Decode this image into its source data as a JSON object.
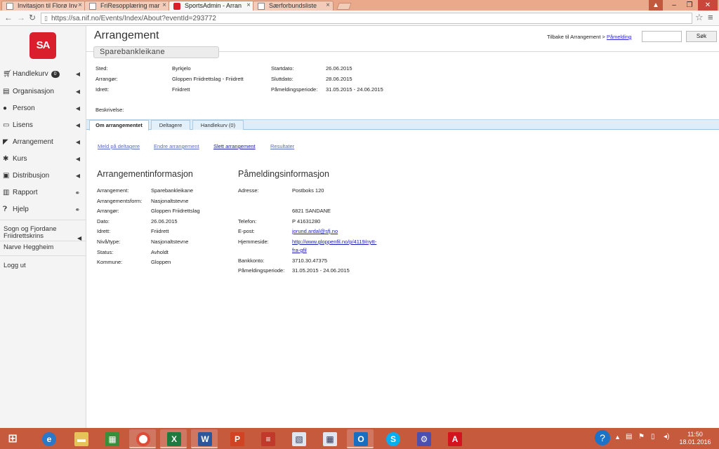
{
  "browser": {
    "tabs": [
      {
        "title": "Invitasjon til Florø Inv"
      },
      {
        "title": "FriResopplæring mar"
      },
      {
        "title": "SportsAdmin - Arran"
      },
      {
        "title": "Særforbundsliste"
      }
    ],
    "url": "https://sa.nif.no/Events/Index/About?eventId=293772"
  },
  "sidebar": {
    "logo": "SA",
    "items": [
      {
        "label": "Handlekurv",
        "badge": "0"
      },
      {
        "label": "Organisasjon"
      },
      {
        "label": "Person"
      },
      {
        "label": "Lisens"
      },
      {
        "label": "Arrangement"
      },
      {
        "label": "Kurs"
      },
      {
        "label": "Distribusjon"
      },
      {
        "label": "Rapport"
      },
      {
        "label": "Hjelp"
      }
    ],
    "organization": "Sogn og Fjordane Friidrettskrins",
    "user": "Narve Heggheim",
    "logout": "Logg ut"
  },
  "header": {
    "title": "Arrangement",
    "breadcrumb_text": "Tilbake til Arrangement >",
    "breadcrumb_link": "Påmelding",
    "search_button": "Søk",
    "event_name": "Sparebankleikane"
  },
  "summary": {
    "sted_label": "Sted:",
    "sted": "Byrkjelo",
    "arrangor_label": "Arrangør:",
    "arrangor": "Gloppen Friidrettslag - Friidrett",
    "idrett_label": "Idrett:",
    "idrett": "Friidrett",
    "startdato_label": "Startdato:",
    "startdato": "26.06.2015",
    "sluttdato_label": "Sluttdato:",
    "sluttdato": "28.06.2015",
    "pamelding_label": "Påmeldingsperiode:",
    "pamelding": "31.05.2015 - 24.06.2015",
    "beskrivelse_label": "Beskrivelse:"
  },
  "content_tabs": [
    {
      "label": "Om arrangementet"
    },
    {
      "label": "Deltagere"
    },
    {
      "label": "Handlekurv (0)"
    }
  ],
  "actions": [
    {
      "label": "Meld på deltagere"
    },
    {
      "label": "Endre arrangement"
    },
    {
      "label": "Slett arrangement"
    },
    {
      "label": "Resultater"
    }
  ],
  "arrangement_info": {
    "title": "Arrangementinformasjon",
    "rows": [
      {
        "label": "Arrangement:",
        "value": "Sparebankleikane"
      },
      {
        "label": "Arrangementsform:",
        "value": "Nasjonaltstevne"
      },
      {
        "label": "Arrangør:",
        "value": "Gloppen Friidrettslag"
      },
      {
        "label": "Dato:",
        "value": "26.06.2015"
      },
      {
        "label": "Idrett:",
        "value": "Friidrett"
      },
      {
        "label": "Nivå/type:",
        "value": "Nasjonaltstevne"
      },
      {
        "label": "Status:",
        "value": "Avholdt"
      },
      {
        "label": "Kommune:",
        "value": "Gloppen"
      }
    ]
  },
  "pamelding_info": {
    "title": "Påmeldingsinformasjon",
    "adresse_label": "Adresse:",
    "adresse1": "Postboks 120",
    "adresse2": "6821 SANDANE",
    "telefon_label": "Telefon:",
    "telefon": "P 41631280",
    "epost_label": "E-post:",
    "epost": "jorund.ardal@sfj.no",
    "hjemmeside_label": "Hjemmeside:",
    "hjemmeside1": "http://www.gloppenfil.no/p/4119/nytt-",
    "hjemmeside2": "fra-gfil",
    "bankkonto_label": "Bankkonto:",
    "bankkonto": "3710.30.47375",
    "periode_label": "Påmeldingsperiode:",
    "periode": "31.05.2015 - 24.06.2015"
  },
  "taskbar": {
    "time": "11:50",
    "date": "18.01.2016"
  }
}
